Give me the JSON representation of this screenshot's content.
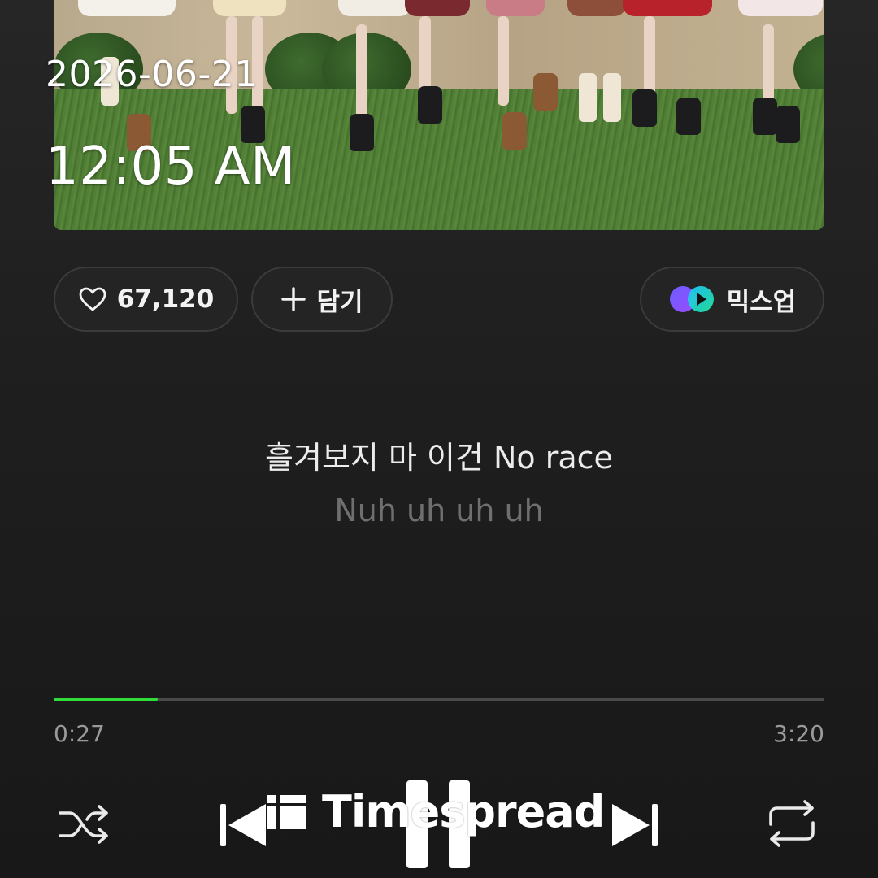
{
  "overlay": {
    "date": "2026-06-21",
    "time": "12:05 AM"
  },
  "actions": {
    "like_count": "67,120",
    "add_label": "담기",
    "mixup_label": "믹스업"
  },
  "lyrics": {
    "current": "흘겨보지 마 이건 No race",
    "next": "Nuh uh uh uh"
  },
  "playback": {
    "elapsed": "0:27",
    "total": "3:20",
    "progress_fraction": 0.135,
    "state": "playing"
  },
  "colors": {
    "accent": "#2fdc3a",
    "background": "#1e1e1e",
    "text": "#ececec",
    "muted": "#6f6f6f"
  },
  "icons": {
    "like": "heart-icon",
    "add": "plus-icon",
    "mixup": "mixup-icon",
    "shuffle": "shuffle-icon",
    "previous": "skip-previous-icon",
    "pause": "pause-icon",
    "next": "skip-next-icon",
    "repeat": "repeat-icon"
  },
  "watermark": {
    "text": "Timespread"
  }
}
